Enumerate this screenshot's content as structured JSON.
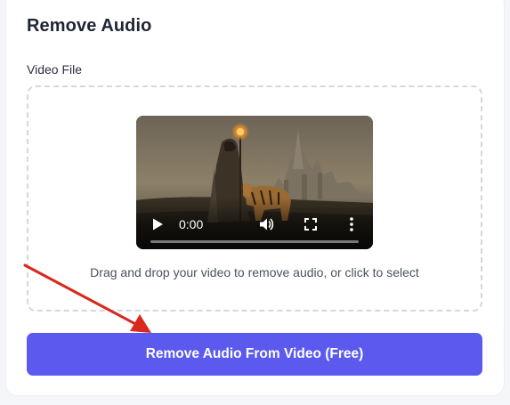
{
  "panel": {
    "title": "Remove Audio",
    "video_field_label": "Video File"
  },
  "video_player": {
    "time": "0:00",
    "progress": 0,
    "controls": [
      "play-icon",
      "volume-icon",
      "fullscreen-icon",
      "more-options-icon"
    ]
  },
  "dropzone": {
    "hint": "Drag and drop your video to remove audio, or click to select"
  },
  "action": {
    "button_label": "Remove Audio From Video (Free)"
  },
  "colors": {
    "accent": "#5b59ee",
    "annotation_arrow": "#d9281e",
    "dropzone_border": "#d4d7de"
  }
}
